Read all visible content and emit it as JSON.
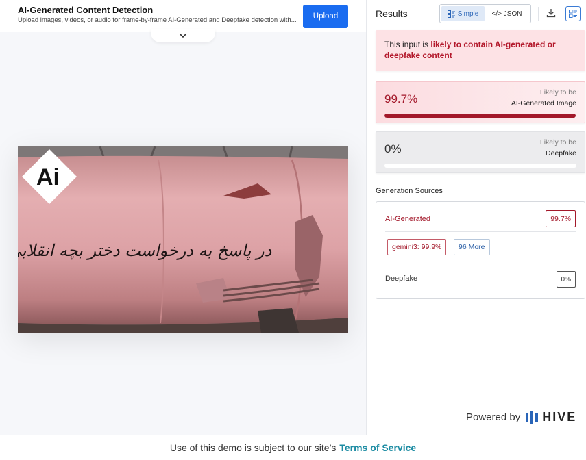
{
  "header": {
    "title": "AI-Generated Content Detection",
    "subtitle": "Upload images, videos, or audio for frame-by-frame AI-Generated and Deepfake detection with...",
    "upload_label": "Upload"
  },
  "preview": {
    "badge_text": "Ai",
    "inscription": "در پاسخ به درخواست دختر بچه انقلابی"
  },
  "results": {
    "title": "Results",
    "view_toggle": {
      "simple": "Simple",
      "json": "</> JSON"
    },
    "verdict": {
      "prefix": "This input is ",
      "highlight": "likely to contain AI-generated or deepfake content"
    },
    "scores": [
      {
        "percent": "99.7%",
        "caption": "Likely to be",
        "label": "AI-Generated Image",
        "fraction": 0.997
      },
      {
        "percent": "0%",
        "caption": "Likely to be",
        "label": "Deepfake",
        "fraction": 0.0
      }
    ],
    "generation_sources": {
      "title": "Generation Sources",
      "ai_label": "AI-Generated",
      "ai_score": "99.7%",
      "model_chip": "gemini3: 99.9%",
      "more_chip": "96 More",
      "deepfake_label": "Deepfake",
      "deepfake_score": "0%"
    },
    "powered_by": {
      "text": "Powered by",
      "brand": "HIVE"
    }
  },
  "footer": {
    "text": "Use of this demo is subject to our site’s",
    "link": "Terms of Service"
  },
  "colors": {
    "accent_blue": "#1a6cf0",
    "ai_red": "#a3182a",
    "verdict_bg": "#fde2e5",
    "tos_link": "#1d8ca3"
  },
  "icons": [
    "chevron-down-icon",
    "simple-view-icon",
    "download-icon",
    "layout-icon",
    "hive-logo-icon"
  ]
}
